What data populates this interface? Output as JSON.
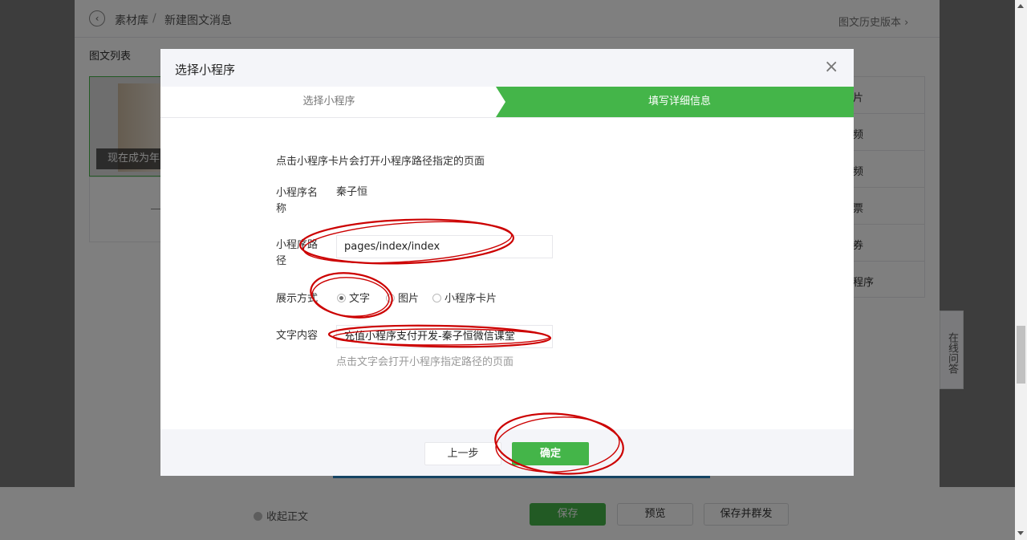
{
  "background_page": {
    "breadcrumb": {
      "root": "素材库",
      "separator": "/",
      "current": "新建图文消息"
    },
    "history_link": "图文历史版本",
    "history_arrow": "›",
    "list_title": "图文列表",
    "card_caption": "现在成为年",
    "right_items": [
      "片",
      "频",
      "频",
      "票",
      "券",
      "程序"
    ],
    "qa_tab": "在线问答",
    "collapse_label": "收起正文",
    "buttons": {
      "save": "保存",
      "preview": "预览",
      "save_publish": "保存并群发"
    }
  },
  "dialog": {
    "title": "选择小程序",
    "close_icon": "×",
    "steps": [
      "选择小程序",
      "填写详细信息"
    ],
    "active_step": 2,
    "intro": "点击小程序卡片会打开小程序路径指定的页面",
    "fields": {
      "name_label": "小程序名称",
      "name_value": "秦子恒",
      "path_label": "小程序路径",
      "path_value": "pages/index/index",
      "display_label": "展示方式",
      "display_options": [
        "文字",
        "图片",
        "小程序卡片"
      ],
      "display_selected": "文字",
      "text_label": "文字内容",
      "text_value": "充值小程序支付开发-秦子恒微信课堂",
      "text_hint": "点击文字会打开小程序指定路径的页面"
    },
    "buttons": {
      "prev": "上一步",
      "ok": "确定"
    }
  },
  "colors": {
    "accent_green": "#44b549",
    "annotation_red": "#cc0000",
    "overlay": "rgba(0,0,0,0.5)"
  }
}
